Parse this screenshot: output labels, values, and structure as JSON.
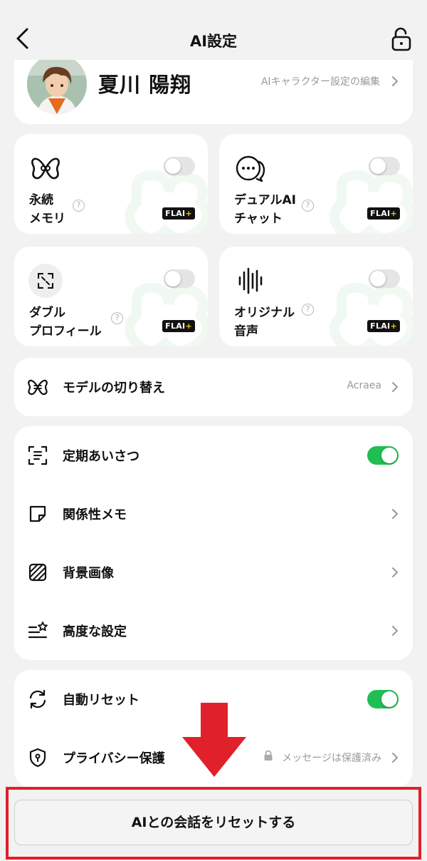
{
  "header": {
    "title": "AI設定"
  },
  "profile": {
    "name": "夏川 陽翔",
    "edit_label": "AIキャラクター設定の編集"
  },
  "features": [
    {
      "line1": "永続",
      "line2": "メモリ",
      "badge": "FLAI",
      "badge_plus": "+",
      "enabled": false
    },
    {
      "line1": "デュアルAI",
      "line2": "チャット",
      "badge": "FLAI",
      "badge_plus": "+",
      "enabled": false
    },
    {
      "line1": "ダブル",
      "line2": "プロフィール",
      "badge": "FLAI",
      "badge_plus": "+",
      "enabled": false
    },
    {
      "line1": "オリジナル",
      "line2": "音声",
      "badge": "FLAI",
      "badge_plus": "+",
      "enabled": false
    }
  ],
  "model": {
    "label": "モデルの切り替え",
    "value": "Acraea"
  },
  "settings": [
    {
      "label": "定期あいさつ",
      "toggle": true
    },
    {
      "label": "関係性メモ"
    },
    {
      "label": "背景画像"
    },
    {
      "label": "高度な設定"
    }
  ],
  "reset_group": [
    {
      "label": "自動リセット",
      "toggle": true
    },
    {
      "label": "プライバシー保護",
      "value": "メッセージは保護済み"
    }
  ],
  "reset_button": {
    "label": "AIとの会話をリセットする"
  },
  "colors": {
    "accent_green": "#1fbf54",
    "highlight_red": "#e0202a"
  }
}
